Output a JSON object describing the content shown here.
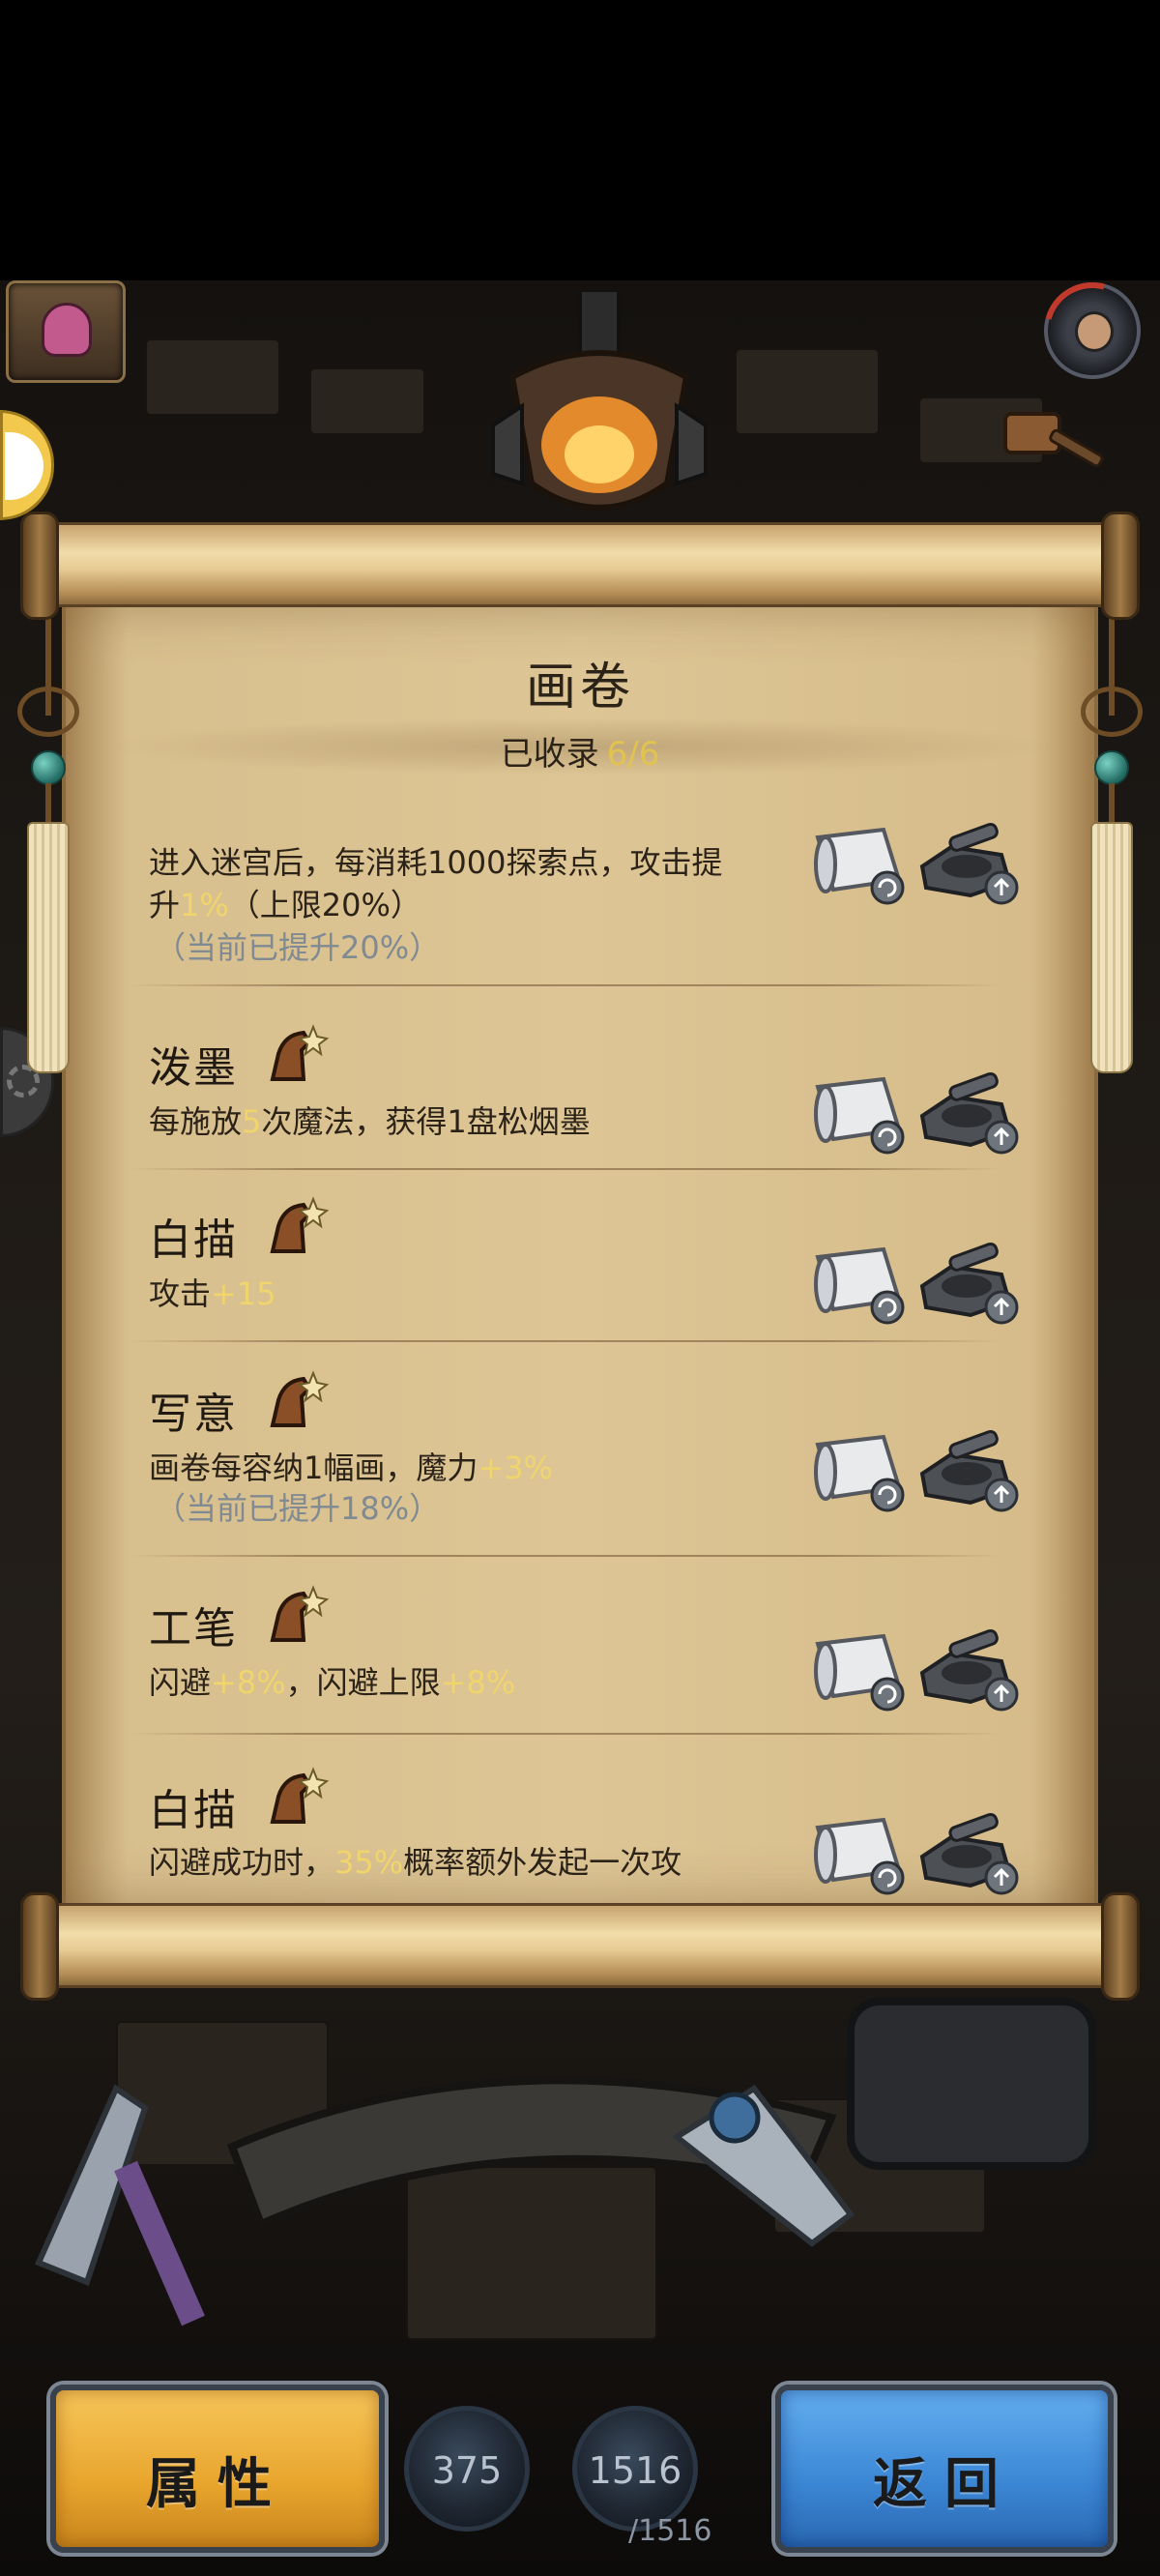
{
  "scroll": {
    "title": "画卷",
    "collected_label": "已收录",
    "collected_count": "6/6"
  },
  "entries": [
    {
      "name": "",
      "desc": [
        "进入迷宫后，每消耗1000探索点，攻击提",
        "升",
        "1%",
        "（上限20%）"
      ],
      "note": "（当前已提升20%）"
    },
    {
      "name": "泼墨",
      "desc": [
        "每施放",
        "5",
        "次魔法，获得1盘松烟墨"
      ]
    },
    {
      "name": "白描",
      "desc": [
        "攻击",
        "+15"
      ]
    },
    {
      "name": "写意",
      "desc": [
        "画卷每容纳1幅画，魔力",
        "+3%"
      ],
      "note": "（当前已提升18%）"
    },
    {
      "name": "工笔",
      "desc": [
        "闪避",
        "+8%",
        "，闪避上限",
        "+8%"
      ]
    },
    {
      "name": "白描",
      "desc": [
        "闪避成功时，",
        "35%",
        "概率额外发起一次攻"
      ]
    }
  ],
  "bottom_bar": {
    "attr_label": "属性",
    "back_label": "返回",
    "stat_a": "375",
    "stat_b": "1516",
    "stat_b_max": "/1516"
  },
  "colors": {
    "highlight": "#f0d46c",
    "note": "#7f8a92",
    "attr_button": "#e8a52d",
    "back_button": "#3b86d4"
  },
  "icons": [
    "ghost-icon",
    "avatar-icon",
    "pet-icon",
    "gear-icon",
    "horse-rank-icon",
    "scroll-icon",
    "ink-stone-icon",
    "refresh-badge-icon",
    "upgrade-badge-icon"
  ]
}
